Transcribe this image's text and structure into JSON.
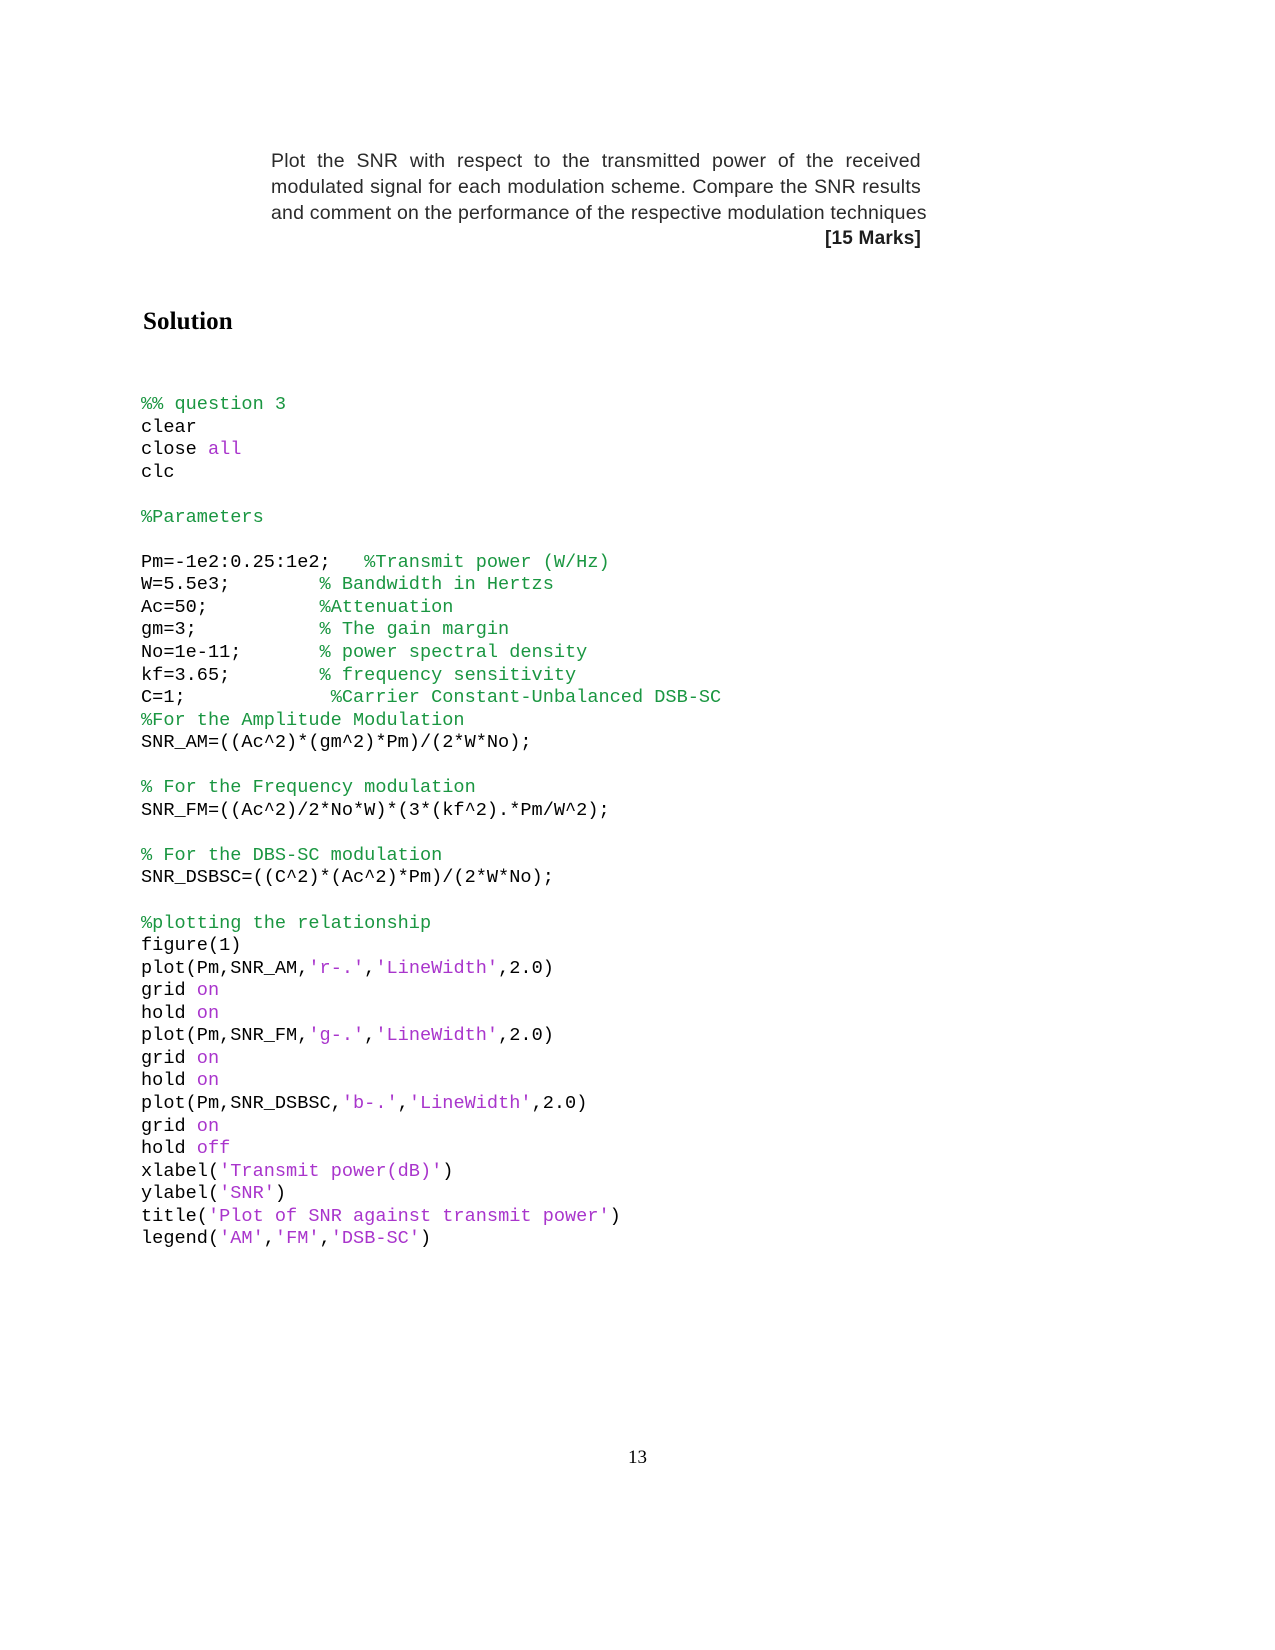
{
  "document": {
    "page_number": "13"
  },
  "question": {
    "lines": [
      "Plot the SNR with respect to the transmitted power of the received",
      "modulated signal for each modulation scheme. Compare the SNR results",
      "and comment on the performance of the respective modulation techniques"
    ],
    "line1_words": [
      "Plot",
      "the",
      "SNR",
      "with",
      "respect",
      "to",
      "the",
      "transmitted",
      "power",
      "of",
      "the",
      "received"
    ],
    "line2_words": [
      "modulated",
      "signal",
      "for",
      "each",
      "modulation",
      "scheme.",
      "Compare",
      "the",
      "SNR",
      "results"
    ],
    "line3": "and comment on the performance of the respective modulation techniques",
    "marks": "[15 Marks]"
  },
  "solution": {
    "heading": "Solution"
  },
  "code": {
    "language": "MATLAB",
    "colors": {
      "comment": "#1a9641",
      "string": "#a935cc",
      "keyword": "#a935cc",
      "plain": "#000000"
    },
    "lines": [
      [
        {
          "t": "comment",
          "v": "%% question 3"
        }
      ],
      [
        {
          "t": "plain",
          "v": "clear"
        }
      ],
      [
        {
          "t": "plain",
          "v": "close "
        },
        {
          "t": "kw",
          "v": "all"
        }
      ],
      [
        {
          "t": "plain",
          "v": "clc"
        }
      ],
      [
        {
          "t": "plain",
          "v": ""
        }
      ],
      [
        {
          "t": "comment",
          "v": "%Parameters"
        }
      ],
      [
        {
          "t": "plain",
          "v": ""
        }
      ],
      [
        {
          "t": "plain",
          "v": "Pm=-1e2:0.25:1e2;   "
        },
        {
          "t": "comment",
          "v": "%Transmit power (W/Hz)"
        }
      ],
      [
        {
          "t": "plain",
          "v": "W=5.5e3;        "
        },
        {
          "t": "comment",
          "v": "% Bandwidth in Hertzs"
        }
      ],
      [
        {
          "t": "plain",
          "v": "Ac=50;          "
        },
        {
          "t": "comment",
          "v": "%Attenuation"
        }
      ],
      [
        {
          "t": "plain",
          "v": "gm=3;           "
        },
        {
          "t": "comment",
          "v": "% The gain margin"
        }
      ],
      [
        {
          "t": "plain",
          "v": "No=1e-11;       "
        },
        {
          "t": "comment",
          "v": "% power spectral density"
        }
      ],
      [
        {
          "t": "plain",
          "v": "kf=3.65;        "
        },
        {
          "t": "comment",
          "v": "% frequency sensitivity"
        }
      ],
      [
        {
          "t": "plain",
          "v": "C=1;             "
        },
        {
          "t": "comment",
          "v": "%Carrier Constant-Unbalanced DSB-SC"
        }
      ],
      [
        {
          "t": "comment",
          "v": "%For the Amplitude Modulation"
        }
      ],
      [
        {
          "t": "plain",
          "v": "SNR_AM=((Ac^2)*(gm^2)*Pm)/(2*W*No);"
        }
      ],
      [
        {
          "t": "plain",
          "v": ""
        }
      ],
      [
        {
          "t": "comment",
          "v": "% For the Frequency modulation"
        }
      ],
      [
        {
          "t": "plain",
          "v": "SNR_FM=((Ac^2)/2*No*W)*(3*(kf^2).*Pm/W^2);"
        }
      ],
      [
        {
          "t": "plain",
          "v": ""
        }
      ],
      [
        {
          "t": "comment",
          "v": "% For the DBS-SC modulation"
        }
      ],
      [
        {
          "t": "plain",
          "v": "SNR_DSBSC=((C^2)*(Ac^2)*Pm)/(2*W*No);"
        }
      ],
      [
        {
          "t": "plain",
          "v": ""
        }
      ],
      [
        {
          "t": "comment",
          "v": "%plotting the relationship"
        }
      ],
      [
        {
          "t": "plain",
          "v": "figure(1)"
        }
      ],
      [
        {
          "t": "plain",
          "v": "plot(Pm,SNR_AM,"
        },
        {
          "t": "string",
          "v": "'r-.'"
        },
        {
          "t": "plain",
          "v": ","
        },
        {
          "t": "string",
          "v": "'LineWidth'"
        },
        {
          "t": "plain",
          "v": ",2.0)"
        }
      ],
      [
        {
          "t": "plain",
          "v": "grid "
        },
        {
          "t": "kw",
          "v": "on"
        }
      ],
      [
        {
          "t": "plain",
          "v": "hold "
        },
        {
          "t": "kw",
          "v": "on"
        }
      ],
      [
        {
          "t": "plain",
          "v": "plot(Pm,SNR_FM,"
        },
        {
          "t": "string",
          "v": "'g-.'"
        },
        {
          "t": "plain",
          "v": ","
        },
        {
          "t": "string",
          "v": "'LineWidth'"
        },
        {
          "t": "plain",
          "v": ",2.0)"
        }
      ],
      [
        {
          "t": "plain",
          "v": "grid "
        },
        {
          "t": "kw",
          "v": "on"
        }
      ],
      [
        {
          "t": "plain",
          "v": "hold "
        },
        {
          "t": "kw",
          "v": "on"
        }
      ],
      [
        {
          "t": "plain",
          "v": "plot(Pm,SNR_DSBSC,"
        },
        {
          "t": "string",
          "v": "'b-.'"
        },
        {
          "t": "plain",
          "v": ","
        },
        {
          "t": "string",
          "v": "'LineWidth'"
        },
        {
          "t": "plain",
          "v": ",2.0)"
        }
      ],
      [
        {
          "t": "plain",
          "v": "grid "
        },
        {
          "t": "kw",
          "v": "on"
        }
      ],
      [
        {
          "t": "plain",
          "v": "hold "
        },
        {
          "t": "kw",
          "v": "off"
        }
      ],
      [
        {
          "t": "plain",
          "v": "xlabel("
        },
        {
          "t": "string",
          "v": "'Transmit power(dB)'"
        },
        {
          "t": "plain",
          "v": ")"
        }
      ],
      [
        {
          "t": "plain",
          "v": "ylabel("
        },
        {
          "t": "string",
          "v": "'SNR'"
        },
        {
          "t": "plain",
          "v": ")"
        }
      ],
      [
        {
          "t": "plain",
          "v": "title("
        },
        {
          "t": "string",
          "v": "'Plot of SNR against transmit power'"
        },
        {
          "t": "plain",
          "v": ")"
        }
      ],
      [
        {
          "t": "plain",
          "v": "legend("
        },
        {
          "t": "string",
          "v": "'AM'"
        },
        {
          "t": "plain",
          "v": ","
        },
        {
          "t": "string",
          "v": "'FM'"
        },
        {
          "t": "plain",
          "v": ","
        },
        {
          "t": "string",
          "v": "'DSB-SC'"
        },
        {
          "t": "plain",
          "v": ")"
        }
      ]
    ]
  }
}
